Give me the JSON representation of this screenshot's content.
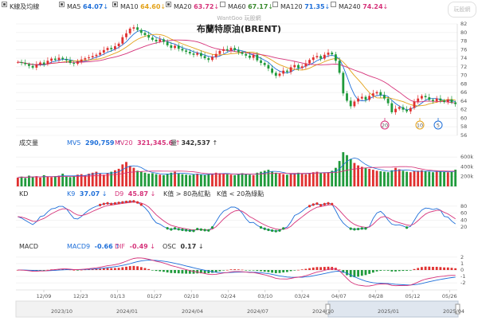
{
  "header": {
    "kline_label": "K線及均線",
    "ma": [
      {
        "label": "MA5",
        "value": "64.07",
        "arrow": "↓",
        "color": "#1e6fd9"
      },
      {
        "label": "MA10",
        "value": "64.60",
        "arrow": "↓",
        "color": "#e3a21a"
      },
      {
        "label": "MA20",
        "value": "63.72",
        "arrow": "↓",
        "color": "#d6337a"
      },
      {
        "label": "MA60",
        "value": "67.17",
        "arrow": "↓",
        "color": "#3a8a2e"
      },
      {
        "label": "MA120",
        "value": "71.35",
        "arrow": "↓",
        "color": "#1e6fd9"
      },
      {
        "label": "MA240",
        "value": "74.24",
        "arrow": "↓",
        "color": "#d6337a"
      }
    ],
    "logo_text": "玩股網"
  },
  "chart_main": {
    "source_text": "WantGoo 玩股網",
    "title": "布蘭特原油(BRENT)",
    "y_ticks": [
      82,
      80,
      78,
      76,
      74,
      72,
      70,
      68,
      66,
      64,
      62,
      60,
      58,
      56
    ],
    "markers": [
      {
        "label": "20",
        "color": "#d6337a"
      },
      {
        "label": "10",
        "color": "#e3a21a"
      },
      {
        "label": "5",
        "color": "#1e6fd9"
      }
    ]
  },
  "volume": {
    "label": "成交量",
    "mv5_label": "MV5",
    "mv5_value": "290,759",
    "mv5_arrow": "↑",
    "mv5_color": "#1e6fd9",
    "mv20_label": "MV20",
    "mv20_value": "321,345.6",
    "mv20_arrow": "↑",
    "mv20_color": "#d6337a",
    "vol_label": "量",
    "vol_value": "342,537",
    "vol_arrow": "↑",
    "y_ticks": [
      "600k",
      "400k",
      "200k"
    ]
  },
  "kd": {
    "label": "KD",
    "k_label": "K9",
    "k_value": "37.07",
    "k_arrow": "↓",
    "k_color": "#1e6fd9",
    "d_label": "D9",
    "d_value": "45.87",
    "d_arrow": "↓",
    "d_color": "#d6337a",
    "note_high": "K值 > 80為紅點",
    "note_low": "K值 < 20為綠點",
    "y_ticks": [
      80,
      60,
      40,
      20
    ]
  },
  "macd": {
    "label": "MACD",
    "macd_label": "MACD9",
    "macd_value": "-0.66",
    "macd_arrow": "↑",
    "macd_color": "#1e6fd9",
    "dif_label": "DIF",
    "dif_value": "-0.49",
    "dif_arrow": "↓",
    "dif_color": "#d6337a",
    "osc_label": "OSC",
    "osc_value": "0.17",
    "osc_arrow": "↓",
    "y_ticks": [
      2,
      1,
      0,
      -1,
      -2
    ]
  },
  "x_axis": {
    "date_ticks": [
      "12/09",
      "12/23",
      "01/13",
      "01/27",
      "02/10",
      "02/24",
      "03/10",
      "03/24",
      "04/07",
      "04/28",
      "05/12",
      "05/26"
    ],
    "nav_ticks": [
      "2023/10",
      "2024/01",
      "2024/04",
      "2024/07",
      "2024/10",
      "2025/01",
      "2025/04"
    ]
  },
  "chart_data": {
    "type": "candlestick",
    "title": "布蘭特原油(BRENT)",
    "ylim": [
      56,
      82
    ],
    "close": [
      73.1,
      72.9,
      72.6,
      72.2,
      71.8,
      72.5,
      73.0,
      72.6,
      73.4,
      73.9,
      73.6,
      74.1,
      73.8,
      73.5,
      72.9,
      72.7,
      73.2,
      73.7,
      74.0,
      74.2,
      74.5,
      74.8,
      75.3,
      75.9,
      76.4,
      76.1,
      76.8,
      77.4,
      78.9,
      79.8,
      80.9,
      81.2,
      80.6,
      79.9,
      79.4,
      78.8,
      78.3,
      77.9,
      78.4,
      77.8,
      77.0,
      76.4,
      76.9,
      76.2,
      75.8,
      75.5,
      75.1,
      74.8,
      75.2,
      74.5,
      74.0,
      73.6,
      74.3,
      75.0,
      75.7,
      76.1,
      75.8,
      76.4,
      75.9,
      75.4,
      75.0,
      74.6,
      74.1,
      74.8,
      73.5,
      72.9,
      72.4,
      71.6,
      70.6,
      69.9,
      70.4,
      71.1,
      70.8,
      71.9,
      72.4,
      71.7,
      72.1,
      72.8,
      73.6,
      74.2,
      74.5,
      73.9,
      74.8,
      75.3,
      74.9,
      73.4,
      70.6,
      65.8,
      64.1,
      62.8,
      63.9,
      64.6,
      65.0,
      64.3,
      65.2,
      65.8,
      66.1,
      65.4,
      64.6,
      63.5,
      61.4,
      62.2,
      62.6,
      62.0,
      61.6,
      62.4,
      63.9,
      64.6,
      65.2,
      64.9,
      64.3,
      64.0,
      64.6,
      64.1,
      63.8,
      64.4,
      63.7,
      63.3
    ],
    "volume_k": [
      180,
      200,
      170,
      220,
      190,
      210,
      180,
      230,
      200,
      190,
      210,
      220,
      260,
      200,
      190,
      210,
      240,
      250,
      230,
      260,
      280,
      300,
      260,
      240,
      270,
      300,
      330,
      360,
      450,
      500,
      420,
      380,
      320,
      300,
      280,
      260,
      270,
      250,
      240,
      230,
      260,
      280,
      300,
      260,
      250,
      240,
      230,
      250,
      260,
      240,
      230,
      250,
      260,
      280,
      270,
      260,
      250,
      240,
      230,
      260,
      270,
      250,
      240,
      230,
      280,
      300,
      320,
      340,
      300,
      280,
      260,
      250,
      240,
      260,
      270,
      280,
      260,
      250,
      270,
      290,
      300,
      280,
      270,
      290,
      320,
      380,
      520,
      700,
      640,
      560,
      480,
      430,
      400,
      380,
      360,
      340,
      320,
      310,
      300,
      290,
      330,
      380,
      350,
      320,
      300,
      290,
      310,
      320,
      330,
      310,
      300,
      290,
      300,
      310,
      300,
      290,
      300,
      342
    ],
    "ma5": [
      64.07
    ],
    "ma10": [
      64.6
    ],
    "ma20": [
      63.72
    ],
    "k9": [
      37.07
    ],
    "d9": [
      45.87
    ],
    "macd9": [
      -0.66
    ],
    "dif": [
      -0.49
    ],
    "osc": [
      0.17
    ]
  }
}
